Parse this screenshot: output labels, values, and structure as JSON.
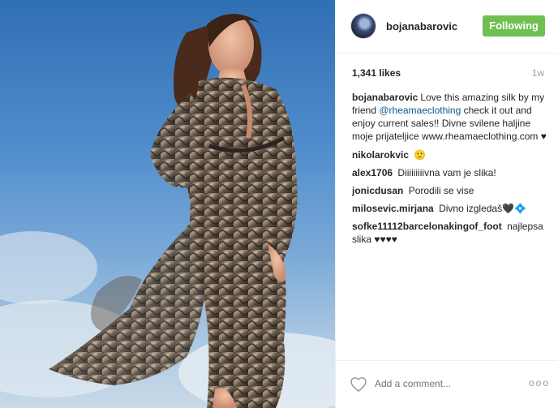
{
  "post": {
    "header": {
      "username": "bojanabarovic",
      "follow_label": "Following",
      "avatar_icon": "avatar-image"
    },
    "likes": "1,341 likes",
    "time": "1w",
    "caption": {
      "user": "bojanabarovic",
      "text_before": "Love this amazing silk by my friend ",
      "mention": "@rheamaeclothing",
      "text_after": " check it out and enjoy current sales!! Divne svilene haljine moje prijateljice www.rheamaeclothing.com ♥"
    },
    "comments": [
      {
        "user": "nikolarokvic",
        "text": "🙂"
      },
      {
        "user": "alex1706",
        "text": "Diiiiiiiiivna vam je slika!"
      },
      {
        "user": "jonicdusan",
        "text": "Porodili se vise"
      },
      {
        "user": "milosevic.mirjana",
        "text": "Divno izgledaš🖤💠"
      },
      {
        "user": "sofke11112barcelonakingof_foot",
        "text": "najlepsa slika ♥♥♥♥"
      }
    ],
    "footer": {
      "comment_placeholder": "Add a comment...",
      "more_label": "ooo",
      "heart_icon": "heart-outline-icon"
    },
    "colors": {
      "follow_button": "#70c050",
      "mention": "#125688"
    }
  }
}
